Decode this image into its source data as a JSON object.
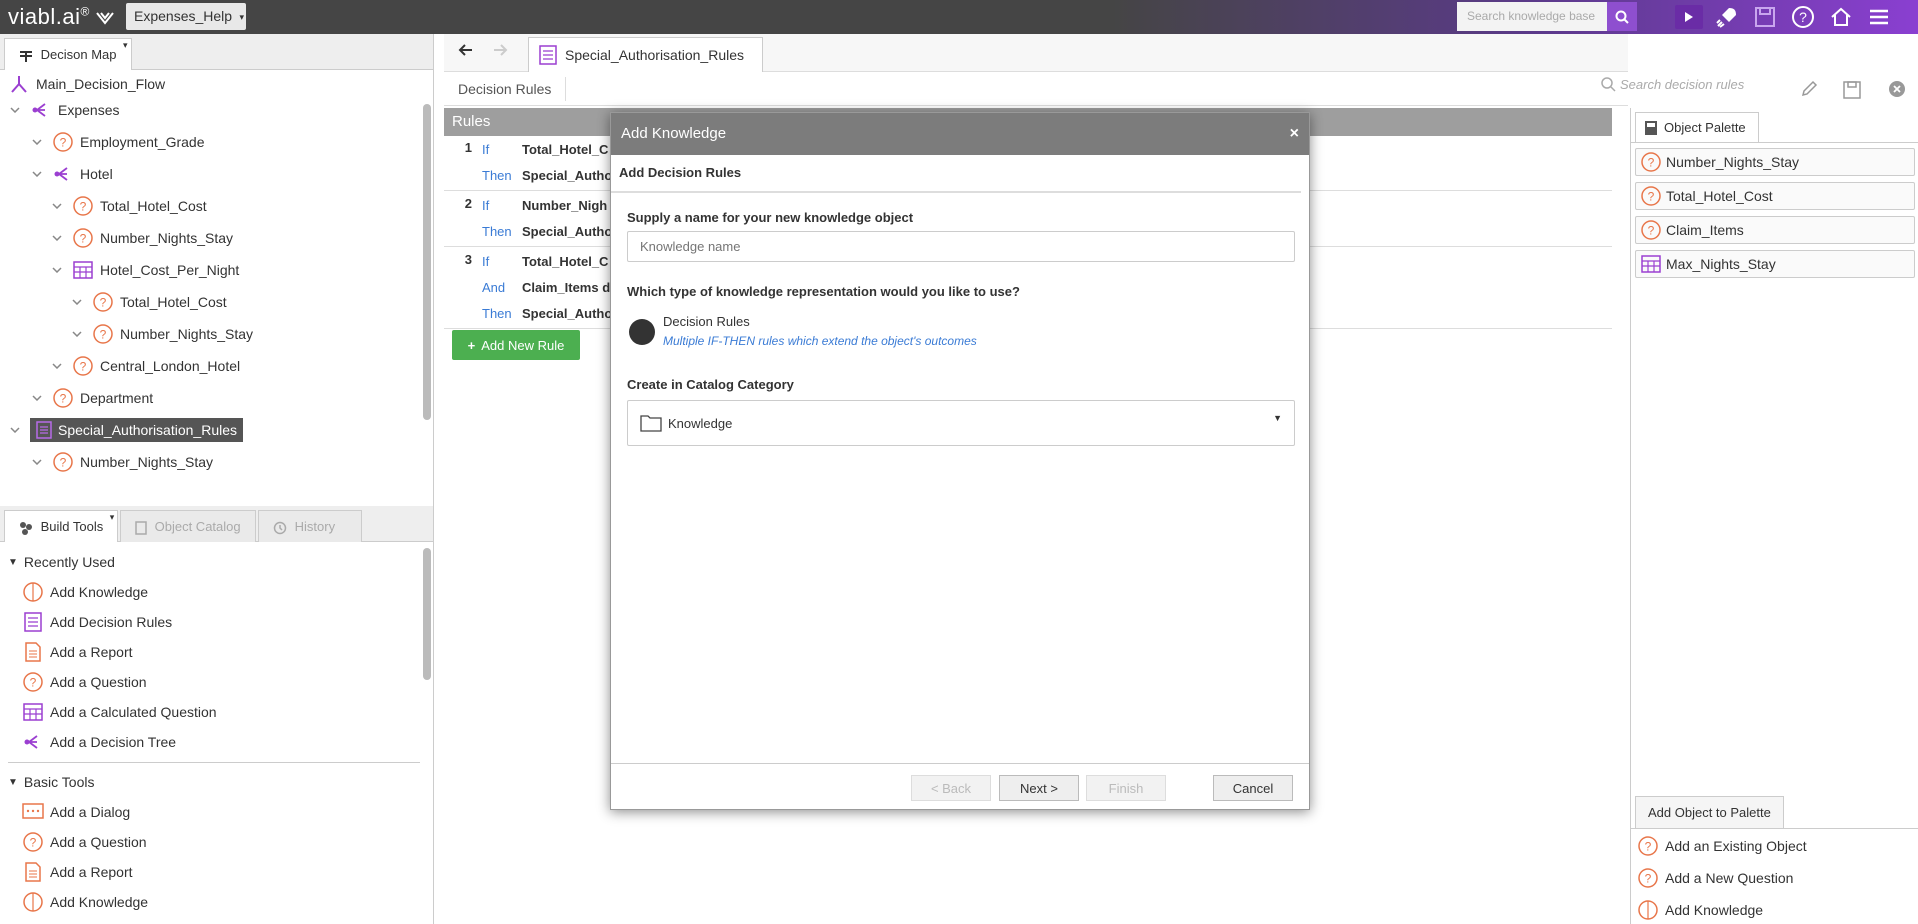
{
  "app": {
    "logo_text": "viabl.ai",
    "logo_mark": "®",
    "kb_tab": "Expenses_Help",
    "search_placeholder": "Search knowledge base"
  },
  "colors": {
    "topbar_dark": "#454545",
    "accent_purple": "#8e4fcf",
    "question_orange": "#e8764a",
    "tree_purple": "#9b3fd1",
    "rule_blue": "#3a7bd5",
    "green": "#4caf50"
  },
  "decision_map": {
    "tab_label": "Decison Map",
    "items": [
      {
        "label": "Main_Decision_Flow",
        "icon": "flow-icon"
      },
      {
        "label": "Expenses",
        "icon": "decision-tree-icon"
      },
      {
        "label": "Employment_Grade",
        "icon": "question-icon"
      },
      {
        "label": "Hotel",
        "icon": "decision-tree-icon"
      },
      {
        "label": "Total_Hotel_Cost",
        "icon": "question-icon"
      },
      {
        "label": "Number_Nights_Stay",
        "icon": "question-icon"
      },
      {
        "label": "Hotel_Cost_Per_Night",
        "icon": "calculated-question-icon"
      },
      {
        "label": "Total_Hotel_Cost",
        "icon": "question-icon"
      },
      {
        "label": "Number_Nights_Stay",
        "icon": "question-icon"
      },
      {
        "label": "Central_London_Hotel",
        "icon": "question-icon"
      },
      {
        "label": "Department",
        "icon": "question-icon"
      },
      {
        "label": "Special_Authorisation_Rules",
        "icon": "decision-rules-icon"
      },
      {
        "label": "Number_Nights_Stay",
        "icon": "question-icon"
      }
    ]
  },
  "build_tools": {
    "tabs": [
      "Build Tools",
      "Object Catalog",
      "History"
    ],
    "recently_used_label": "Recently Used",
    "recently_used": [
      {
        "label": "Add Knowledge",
        "icon": "brain-icon"
      },
      {
        "label": "Add Decision Rules",
        "icon": "decision-rules-icon"
      },
      {
        "label": "Add a Report",
        "icon": "report-icon"
      },
      {
        "label": "Add a Question",
        "icon": "question-icon"
      },
      {
        "label": "Add a Calculated Question",
        "icon": "calculated-question-icon"
      },
      {
        "label": "Add a Decision Tree",
        "icon": "decision-tree-icon"
      }
    ],
    "basic_tools_label": "Basic Tools",
    "basic_tools": [
      {
        "label": "Add a Dialog",
        "icon": "dialog-icon"
      },
      {
        "label": "Add a Question",
        "icon": "question-icon"
      },
      {
        "label": "Add a Report",
        "icon": "report-icon"
      },
      {
        "label": "Add Knowledge",
        "icon": "brain-icon"
      }
    ]
  },
  "editor": {
    "doc_tab": "Special_Authorisation_Rules",
    "subbar_title": "Decision Rules",
    "search_placeholder": "Search decision rules",
    "rules_header": "Rules",
    "rules": [
      {
        "num": "1",
        "lines": [
          {
            "kw": "If",
            "val": "Total_Hotel_C"
          },
          {
            "kw": "Then",
            "val": "Special_Autho"
          }
        ]
      },
      {
        "num": "2",
        "lines": [
          {
            "kw": "If",
            "val": "Number_Nigh"
          },
          {
            "kw": "Then",
            "val": "Special_Autho"
          }
        ]
      },
      {
        "num": "3",
        "lines": [
          {
            "kw": "If",
            "val": "Total_Hotel_C"
          },
          {
            "kw": "And",
            "val": "Claim_Items d"
          },
          {
            "kw": "Then",
            "val": "Special_Autho"
          }
        ]
      }
    ],
    "add_rule_label": "Add New Rule"
  },
  "palette": {
    "tab_label": "Object Palette",
    "items": [
      {
        "label": "Number_Nights_Stay",
        "icon": "question-icon"
      },
      {
        "label": "Total_Hotel_Cost",
        "icon": "question-icon"
      },
      {
        "label": "Claim_Items",
        "icon": "question-icon"
      },
      {
        "label": "Max_Nights_Stay",
        "icon": "calculated-question-icon"
      }
    ],
    "add_tab_label": "Add Object to Palette",
    "add_links": [
      {
        "label": "Add an Existing Object",
        "icon": "question-icon"
      },
      {
        "label": "Add a New Question",
        "icon": "question-icon"
      },
      {
        "label": "Add Knowledge",
        "icon": "brain-icon"
      }
    ]
  },
  "modal": {
    "title": "Add Knowledge",
    "subtitle": "Add Decision Rules",
    "name_label": "Supply a name for your new knowledge object",
    "name_placeholder": "Knowledge name",
    "name_value": "",
    "type_label": "Which type of knowledge representation would you like to use?",
    "option_title": "Decision Rules",
    "option_desc": "Multiple IF-THEN rules which extend the object's outcomes",
    "category_label": "Create in Catalog Category",
    "category_value": "Knowledge",
    "back_label": "< Back",
    "next_label": "Next >",
    "finish_label": "Finish",
    "cancel_label": "Cancel"
  }
}
